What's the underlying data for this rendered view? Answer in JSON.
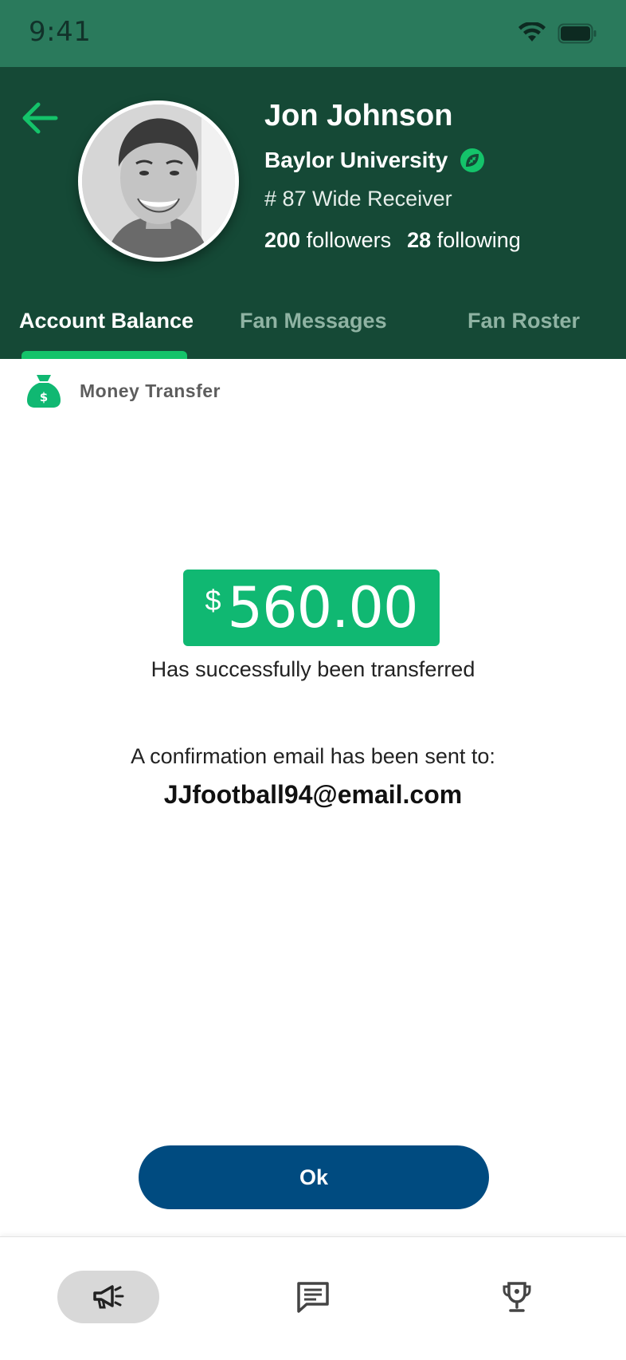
{
  "status_bar": {
    "time": "9:41"
  },
  "profile": {
    "name": "Jon Johnson",
    "school": "Baylor University",
    "position": "# 87 Wide Receiver",
    "followers_count": "200",
    "followers_label": "followers",
    "following_count": "28",
    "following_label": "following"
  },
  "tabs": [
    {
      "label": "Account Balance",
      "active": true
    },
    {
      "label": "Fan Messages",
      "active": false
    },
    {
      "label": "Fan Roster",
      "active": false
    }
  ],
  "section": {
    "title": "Money Transfer"
  },
  "transfer": {
    "currency_symbol": "$",
    "amount": "560.00",
    "status_text": "Has successfully been transferred",
    "confirmation_text": "A confirmation email has been sent to:",
    "email": "JJfootball94@email.com"
  },
  "actions": {
    "ok_label": "Ok"
  },
  "bottom_nav": [
    {
      "icon": "megaphone-icon",
      "active": true
    },
    {
      "icon": "message-icon",
      "active": false
    },
    {
      "icon": "trophy-icon",
      "active": false
    }
  ],
  "colors": {
    "header_bg": "#154936",
    "status_bg": "#2a7a5c",
    "accent_green": "#10b872",
    "tab_indicator": "#14c36a",
    "button_blue": "#004b80"
  }
}
